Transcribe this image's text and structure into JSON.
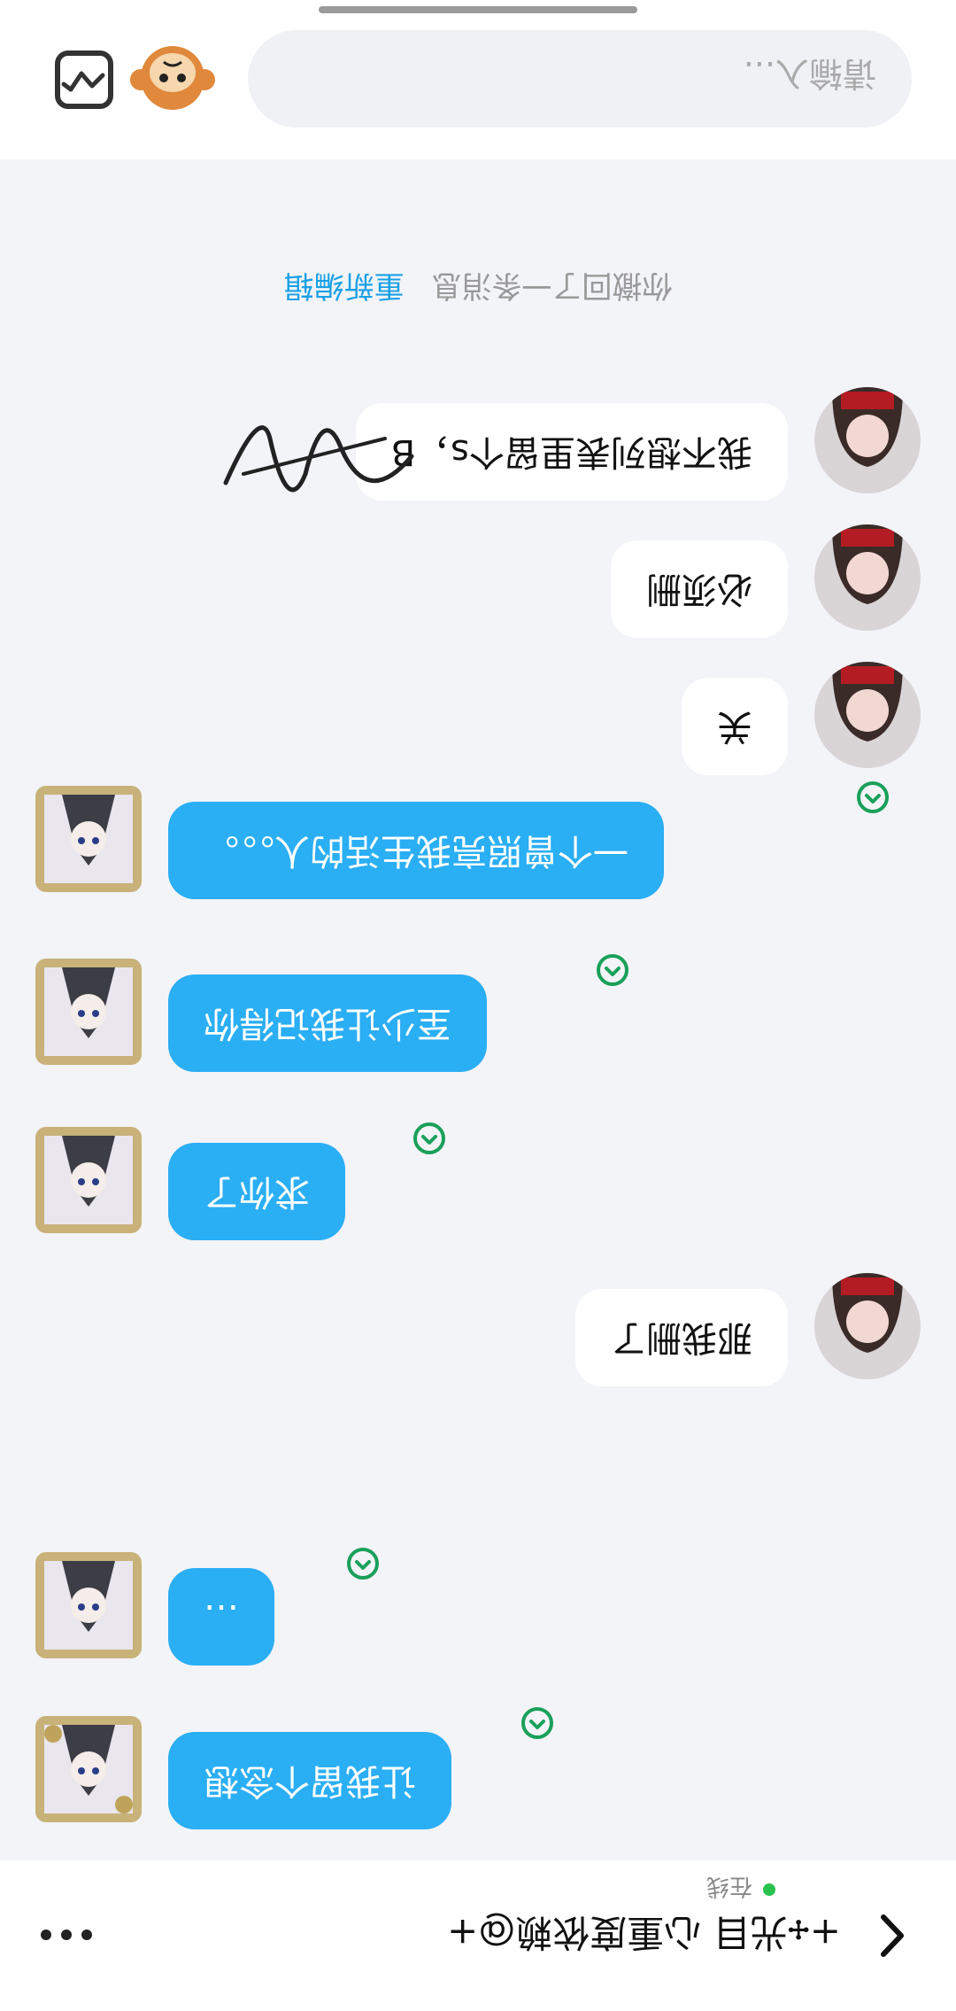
{
  "header": {
    "title": "+🕂光目 心重度依赖@+",
    "status": "在线",
    "more_icon": "more-dots-icon",
    "back_icon": "chevron-left-icon"
  },
  "messages": [
    {
      "side": "other",
      "text": "让我留个念想"
    },
    {
      "side": "other",
      "text": "…"
    },
    {
      "side": "me",
      "text": "那我删了"
    },
    {
      "side": "other",
      "text": "求你了"
    },
    {
      "side": "other",
      "text": "至少让我记得你"
    },
    {
      "side": "other",
      "text": "一个曾照亮我生活的人。。。"
    },
    {
      "side": "me",
      "text": "关"
    },
    {
      "side": "me",
      "text": "必须删"
    },
    {
      "side": "me",
      "text": "我不想列表里留个s，B"
    },
    {
      "side": "other",
      "text": "。。。。"
    }
  ],
  "recall": {
    "text": "你撤回了一条消息",
    "edit_label": "重新编辑"
  },
  "input": {
    "placeholder": "请输入..."
  },
  "colors": {
    "blue_bubble": "#2aaef4",
    "read_check": "#1aa05a",
    "online": "#2bc14e"
  }
}
